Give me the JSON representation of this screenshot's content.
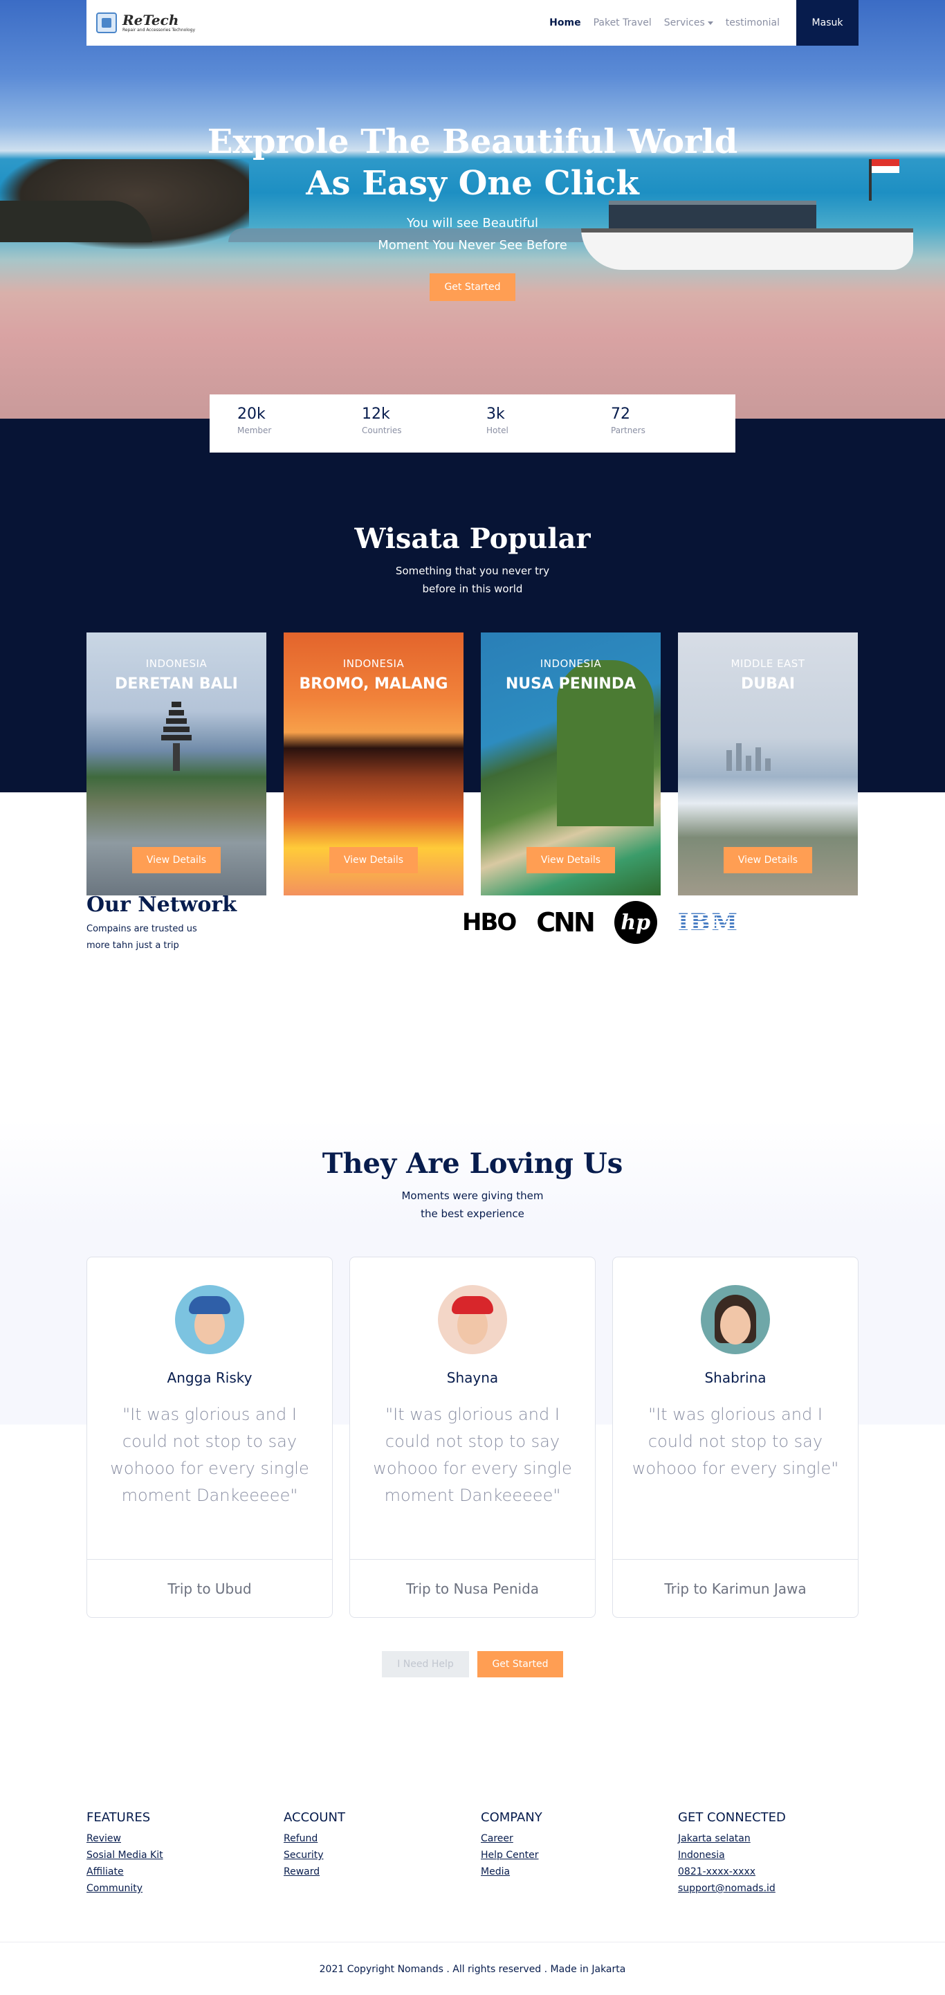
{
  "nav": {
    "brand_name": "ReTech",
    "brand_sub": "Repair and Accessories Technology",
    "links": [
      "Home",
      "Paket Travel",
      "Services",
      "testimonial"
    ],
    "login_label": "Masuk"
  },
  "hero": {
    "title_line1": "Exprole The Beautiful World",
    "title_line2": "As Easy One Click",
    "sub_line1": "You will see Beautiful",
    "sub_line2": "Moment You Never See Before",
    "button": "Get Started"
  },
  "stats": [
    {
      "value": "20k",
      "label": "Member"
    },
    {
      "value": "12k",
      "label": "Countries"
    },
    {
      "value": "3k",
      "label": "Hotel"
    },
    {
      "value": "72",
      "label": "Partners"
    }
  ],
  "popular": {
    "title": "Wisata Popular",
    "sub_line1": "Something that you never try",
    "sub_line2": "before in this world",
    "cards": [
      {
        "country": "INDONESIA",
        "name": "DERETAN BALI",
        "button": "View Details"
      },
      {
        "country": "INDONESIA",
        "name": "BROMO, MALANG",
        "button": "View Details"
      },
      {
        "country": "INDONESIA",
        "name": "NUSA PENINDA",
        "button": "View Details"
      },
      {
        "country": "MIDDLE EAST",
        "name": "DUBAI",
        "button": "View Details"
      }
    ]
  },
  "network": {
    "title": "Our Network",
    "sub_line1": "Compains are trusted us",
    "sub_line2": "more tahn just a trip",
    "logos": [
      "HBO",
      "CNN",
      "hp",
      "IBM"
    ]
  },
  "testimonials": {
    "title": "They Are Loving Us",
    "sub_line1": "Moments were giving them",
    "sub_line2": "the best experience",
    "items": [
      {
        "name": "Angga Risky",
        "quote": "\"It was glorious and I could not stop to say wohooo for every single moment Dankeeeee\"",
        "trip": "Trip to Ubud"
      },
      {
        "name": "Shayna",
        "quote": "\"It was glorious and I could not stop to say wohooo for every single moment Dankeeeee\"",
        "trip": "Trip to Nusa Penida"
      },
      {
        "name": "Shabrina",
        "quote": "\"It was glorious and I could not stop to say wohooo for every single\"",
        "trip": "Trip to Karimun Jawa"
      }
    ],
    "help_button": "I Need Help",
    "start_button": "Get Started"
  },
  "footer": {
    "columns": [
      {
        "title": "FEATURES",
        "links": [
          "Review",
          "Sosial Media Kit",
          "Affiliate",
          "Community"
        ]
      },
      {
        "title": "ACCOUNT",
        "links": [
          "Refund",
          "Security",
          "Reward"
        ]
      },
      {
        "title": "COMPANY",
        "links": [
          "Career",
          "Help Center",
          "Media"
        ]
      },
      {
        "title": "GET CONNECTED",
        "links": [
          "Jakarta selatan",
          "Indonesia",
          "0821-xxxx-xxxx",
          "support@nomads.id"
        ]
      }
    ],
    "copyright": "2021 Copyright Nomands . All rights reserved . Made in Jakarta"
  },
  "colors": {
    "navy": "#071c4d",
    "dark_bg": "#071435",
    "accent": "#ff9e53",
    "muted": "#8a8fa3"
  }
}
